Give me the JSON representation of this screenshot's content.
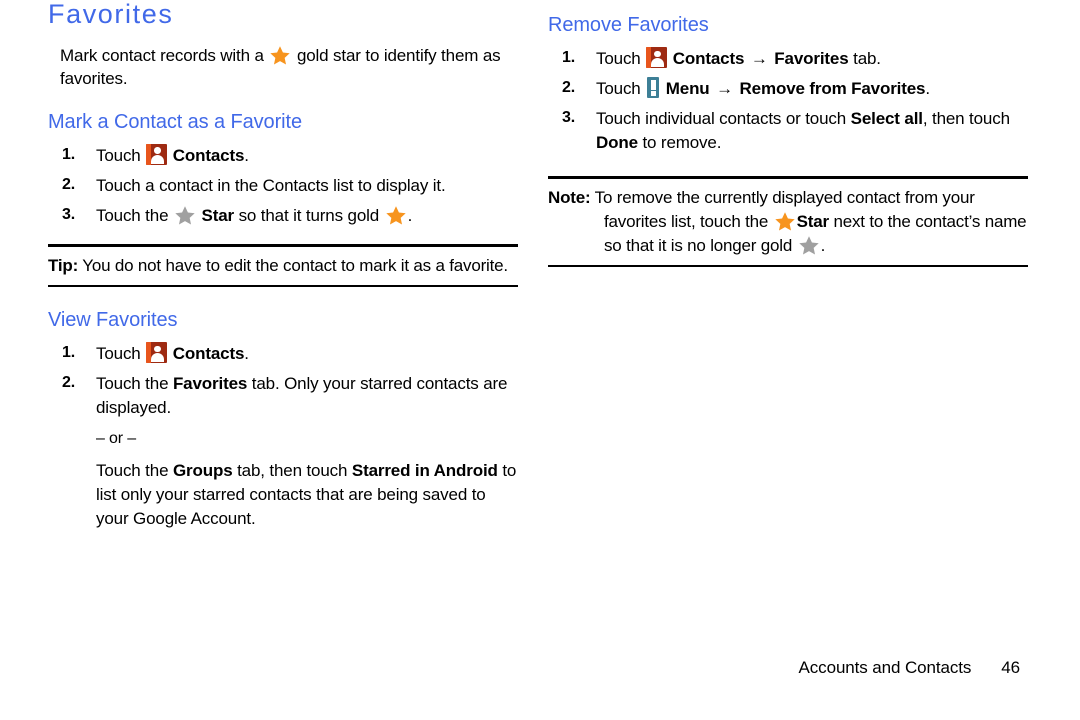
{
  "document": {
    "title": "Favorites",
    "intro": {
      "before_icon": "Mark contact records with a ",
      "after_icon": " gold star to identify them as favorites."
    },
    "colors": {
      "heading_blue": "#4169e8",
      "gold_star": "#f7941e",
      "gray_star": "#a0a0a0",
      "contacts_icon_bg": "#9e2a12",
      "contacts_icon_strip": "#e8551c",
      "menu_icon_bg": "#3d7f96",
      "text": "#000000",
      "page_background": "#ffffff"
    },
    "icons": {
      "contacts": "contacts-icon",
      "menu": "menu-icon",
      "gold_star": "gold-star-icon",
      "gray_star": "gray-star-icon",
      "arrow": "→"
    }
  },
  "left_column": {
    "section_mark": {
      "heading": "Mark a Contact as a Favorite",
      "steps": [
        {
          "number": "1.",
          "parts": [
            {
              "type": "text",
              "value": "Touch "
            },
            {
              "type": "icon",
              "value": "contacts-icon"
            },
            {
              "type": "bold",
              "value": " Contacts"
            },
            {
              "type": "text",
              "value": "."
            }
          ]
        },
        {
          "number": "2.",
          "parts": [
            {
              "type": "text",
              "value": "Touch a contact in the Contacts list to display it."
            }
          ]
        },
        {
          "number": "3.",
          "parts": [
            {
              "type": "text",
              "value": "Touch the "
            },
            {
              "type": "icon",
              "value": "gray-star-icon"
            },
            {
              "type": "bold",
              "value": " Star"
            },
            {
              "type": "text",
              "value": " so that it turns gold "
            },
            {
              "type": "icon",
              "value": "gold-star-icon"
            },
            {
              "type": "text",
              "value": "."
            }
          ]
        }
      ]
    },
    "tip": {
      "label": "Tip:",
      "body": " You do not have to edit the contact to mark it as a favorite."
    },
    "section_view": {
      "heading": "View Favorites",
      "steps": [
        {
          "number": "1.",
          "parts": [
            {
              "type": "text",
              "value": "Touch "
            },
            {
              "type": "icon",
              "value": "contacts-icon"
            },
            {
              "type": "bold",
              "value": " Contacts"
            },
            {
              "type": "text",
              "value": "."
            }
          ]
        },
        {
          "number": "2.",
          "parts": [
            {
              "type": "text",
              "value": "Touch the "
            },
            {
              "type": "bold",
              "value": "Favorites"
            },
            {
              "type": "text",
              "value": " tab. Only your starred contacts are displayed."
            }
          ],
          "or_label": "– or –",
          "alternate_parts": [
            {
              "type": "text",
              "value": "Touch the "
            },
            {
              "type": "bold",
              "value": "Groups"
            },
            {
              "type": "text",
              "value": " tab, then touch "
            },
            {
              "type": "bold",
              "value": "Starred in Android"
            },
            {
              "type": "text",
              "value": " to list only your starred contacts that are being saved to your Google Account."
            }
          ]
        }
      ]
    }
  },
  "right_column": {
    "section_remove": {
      "heading": "Remove Favorites",
      "steps": [
        {
          "number": "1.",
          "parts": [
            {
              "type": "text",
              "value": "Touch "
            },
            {
              "type": "icon",
              "value": "contacts-icon"
            },
            {
              "type": "bold",
              "value": " Contacts "
            },
            {
              "type": "arrow",
              "value": "→"
            },
            {
              "type": "bold",
              "value": " Favorites"
            },
            {
              "type": "text",
              "value": " tab."
            }
          ]
        },
        {
          "number": "2.",
          "parts": [
            {
              "type": "text",
              "value": "Touch "
            },
            {
              "type": "icon",
              "value": "menu-icon"
            },
            {
              "type": "bold",
              "value": " Menu "
            },
            {
              "type": "arrow",
              "value": "→"
            },
            {
              "type": "bold",
              "value": " Remove from Favorites"
            },
            {
              "type": "text",
              "value": "."
            }
          ]
        },
        {
          "number": "3.",
          "parts": [
            {
              "type": "text",
              "value": "Touch individual contacts or touch "
            },
            {
              "type": "bold",
              "value": "Select all"
            },
            {
              "type": "text",
              "value": ", then touch "
            },
            {
              "type": "bold",
              "value": "Done"
            },
            {
              "type": "text",
              "value": " to remove."
            }
          ]
        }
      ]
    },
    "note": {
      "label": "Note:",
      "segment_1": " To remove the currently displayed contact from your favorites list, touch the ",
      "star_1": "gold-star-icon",
      "bold_star": "Star",
      "segment_2": " next to the contact’s name so that it is no longer gold ",
      "star_2": "gray-star-icon",
      "segment_3": "."
    }
  },
  "footer": {
    "chapter": "Accounts and Contacts",
    "page_number": "46"
  }
}
